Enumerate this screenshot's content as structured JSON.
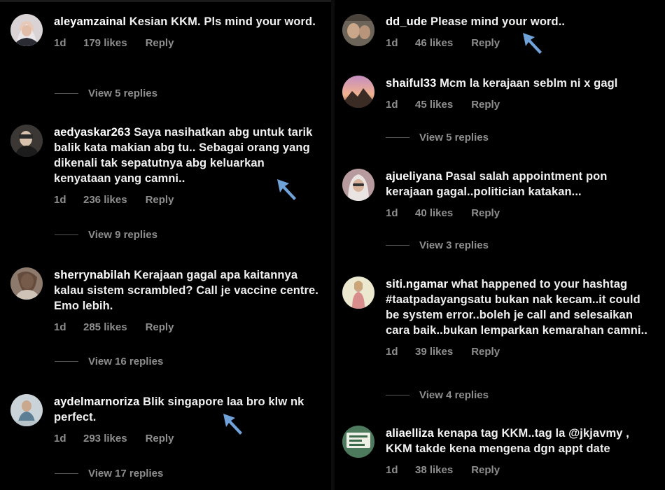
{
  "left_column": {
    "comments": [
      {
        "username": "aleyamzainal",
        "text": "Kesian KKM. Pls mind your word.",
        "age": "1d",
        "likes": "179 likes",
        "reply": "Reply",
        "view_replies": "View 5 replies"
      },
      {
        "username": "aedyaskar263",
        "text": "Saya nasihatkan abg untuk tarik balik kata makian abg tu.. Sebagai orang yang dikenali tak sepatutnya abg keluarkan kenyataan yang camni..",
        "age": "1d",
        "likes": "236 likes",
        "reply": "Reply",
        "view_replies": "View 9 replies"
      },
      {
        "username": "sherrynabilah",
        "text": "Kerajaan gagal apa kaitannya kalau sistem scrambled? Call je vaccine centre. Emo lebih.",
        "age": "1d",
        "likes": "285 likes",
        "reply": "Reply",
        "view_replies": "View 16 replies"
      },
      {
        "username": "aydelmarnoriza",
        "text": "Blik singapore laa bro klw nk perfect.",
        "age": "1d",
        "likes": "293 likes",
        "reply": "Reply",
        "view_replies": "View 17 replies"
      }
    ]
  },
  "right_column": {
    "comments": [
      {
        "username": "dd_ude",
        "text": "Please mind your word..",
        "age": "1d",
        "likes": "46 likes",
        "reply": "Reply"
      },
      {
        "username": "shaiful33",
        "text": "Mcm la kerajaan seblm ni x gagl",
        "age": "1d",
        "likes": "45 likes",
        "reply": "Reply",
        "view_replies": "View 5 replies"
      },
      {
        "username": "ajueliyana",
        "text": "Pasal salah appointment pon kerajaan gagal..politician katakan...",
        "age": "1d",
        "likes": "40 likes",
        "reply": "Reply",
        "view_replies": "View 3 replies"
      },
      {
        "username": "siti.ngamar",
        "text": "what happened to your hashtag #taatpadayangsatu bukan nak kecam..it could be system error..boleh je call and selesaikan cara baik..bukan lemparkan kemarahan camni..",
        "age": "1d",
        "likes": "39 likes",
        "reply": "Reply",
        "view_replies": "View 4 replies"
      },
      {
        "username": "aliaelliza",
        "text": "kenapa tag KKM..tag la @jkjavmy , KKM takde kena mengena dgn appt date",
        "age": "1d",
        "likes": "38 likes",
        "reply": "Reply"
      }
    ]
  },
  "colors": {
    "background": "#000000",
    "text": "#f0f0f0",
    "meta": "#8e8e8e",
    "cursor": "#6fa2d8"
  },
  "icons": {
    "cursor": "arrow-pointer-icon"
  }
}
